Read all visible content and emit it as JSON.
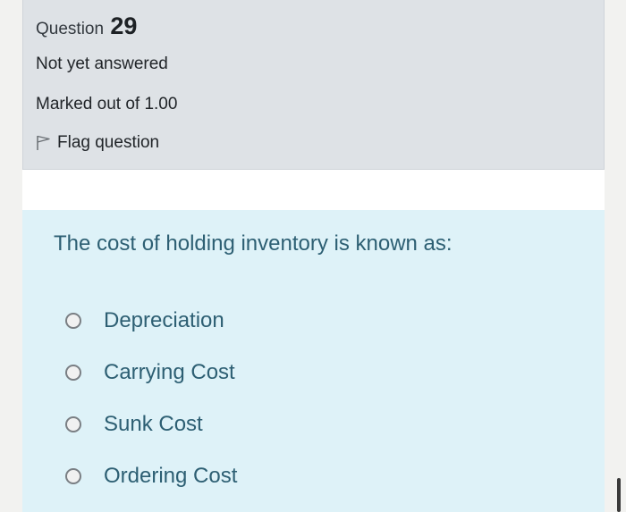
{
  "info": {
    "question_word": "Question",
    "question_number": "29",
    "state": "Not yet answered",
    "grade": "Marked out of 1.00",
    "flag_label": "Flag question"
  },
  "question": {
    "text": "The cost of holding inventory is known as:",
    "options": [
      {
        "label": "Depreciation"
      },
      {
        "label": "Carrying Cost"
      },
      {
        "label": "Sunk Cost"
      },
      {
        "label": "Ordering Cost"
      }
    ]
  },
  "colors": {
    "info_bg": "#dee2e6",
    "question_bg": "#def2f8",
    "question_text": "#2d5f73"
  }
}
